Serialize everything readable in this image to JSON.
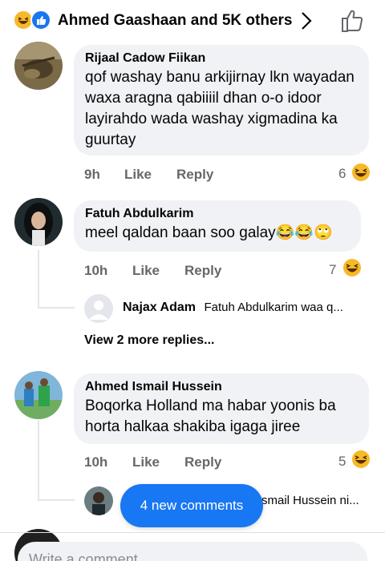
{
  "header": {
    "title": "Ahmed Gaashaan and 5K others"
  },
  "comments": [
    {
      "author": "Rijaal Cadow Fiikan",
      "text": "qof washay banu arkijirnay lkn wayadan waxa aragna qabiiiil dhan o-o idoor layirahdo wada washay xigmadina ka guurtay",
      "time": "9h",
      "like_label": "Like",
      "reply_label": "Reply",
      "reaction_count": "6"
    },
    {
      "author": "Fatuh Abdulkarim",
      "text": "meel qaldan baan soo galay",
      "time": "10h",
      "like_label": "Like",
      "reply_label": "Reply",
      "reaction_count": "7"
    },
    {
      "author": "Ahmed Ismail Hussein",
      "text": "Boqorka Holland  ma habar yoonis ba horta halkaa shakiba igaga jiree",
      "time": "10h",
      "like_label": "Like",
      "reply_label": "Reply",
      "reaction_count": "5"
    }
  ],
  "replies": {
    "first": {
      "name": "Najax Adam",
      "text": "Fatuh Abdulkarim  waa q..."
    },
    "view_more": "View 2 more replies...",
    "second": {
      "text": "smail Hussein ni..."
    }
  },
  "new_comments_button": "4 new comments",
  "composer": {
    "placeholder": "Write a comment..."
  }
}
